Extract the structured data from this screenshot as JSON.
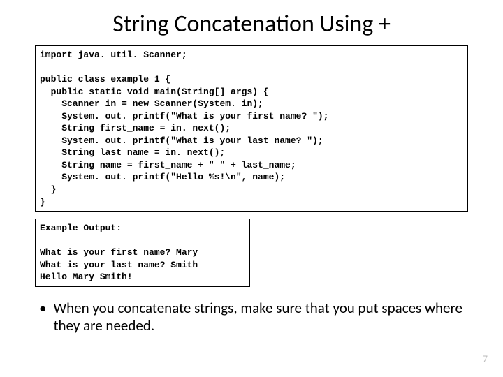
{
  "title": "String Concatenation Using +",
  "code": "import java. util. Scanner;\n\npublic class example 1 {\n  public static void main(String[] args) {\n    Scanner in = new Scanner(System. in);\n    System. out. printf(\"What is your first name? \");\n    String first_name = in. next();\n    System. out. printf(\"What is your last name? \");\n    String last_name = in. next();\n    String name = first_name + \" \" + last_name;\n    System. out. printf(\"Hello %s!\\n\", name);\n  }\n}",
  "output": "Example Output:\n\nWhat is your first name? Mary\nWhat is your last name? Smith\nHello Mary Smith!",
  "bullet": "When you concatenate strings, make sure that you put spaces where they are needed.",
  "pageNumber": "7"
}
